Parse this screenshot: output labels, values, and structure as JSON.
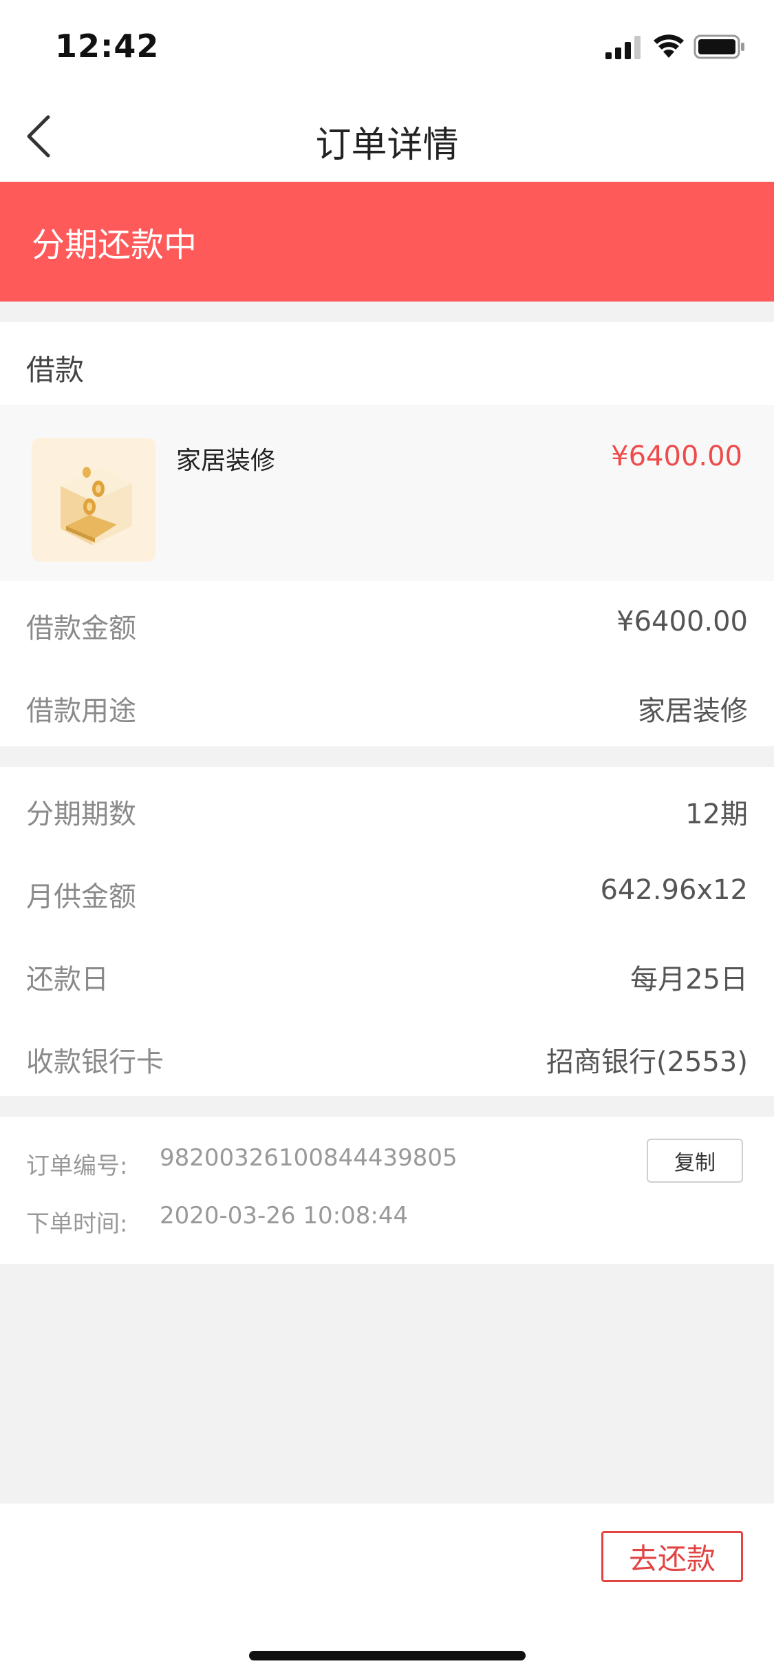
{
  "status_bar": {
    "time": "12:42"
  },
  "nav": {
    "title": "订单详情"
  },
  "banner": {
    "status": "分期还款中",
    "color": "#ff5a5a"
  },
  "section": {
    "title": "借款"
  },
  "product": {
    "name": "家居装修",
    "price": "¥6400.00"
  },
  "loan": {
    "rows": [
      {
        "label": "借款金额",
        "value": "¥6400.00"
      },
      {
        "label": "借款用途",
        "value": "家居装修"
      }
    ]
  },
  "installment": {
    "rows": [
      {
        "label": "分期期数",
        "value": "12期"
      },
      {
        "label": "月供金额",
        "value": "642.96x12"
      },
      {
        "label": "还款日",
        "value": "每月25日"
      },
      {
        "label": "收款银行卡",
        "value": "招商银行(2553)"
      }
    ]
  },
  "order": {
    "number_label": "订单编号:",
    "number": "98200326100844439805",
    "time_label": "下单时间:",
    "time": "2020-03-26 10:08:44",
    "copy_label": "复制"
  },
  "bottom": {
    "pay_label": "去还款",
    "accent": "#e24444"
  }
}
